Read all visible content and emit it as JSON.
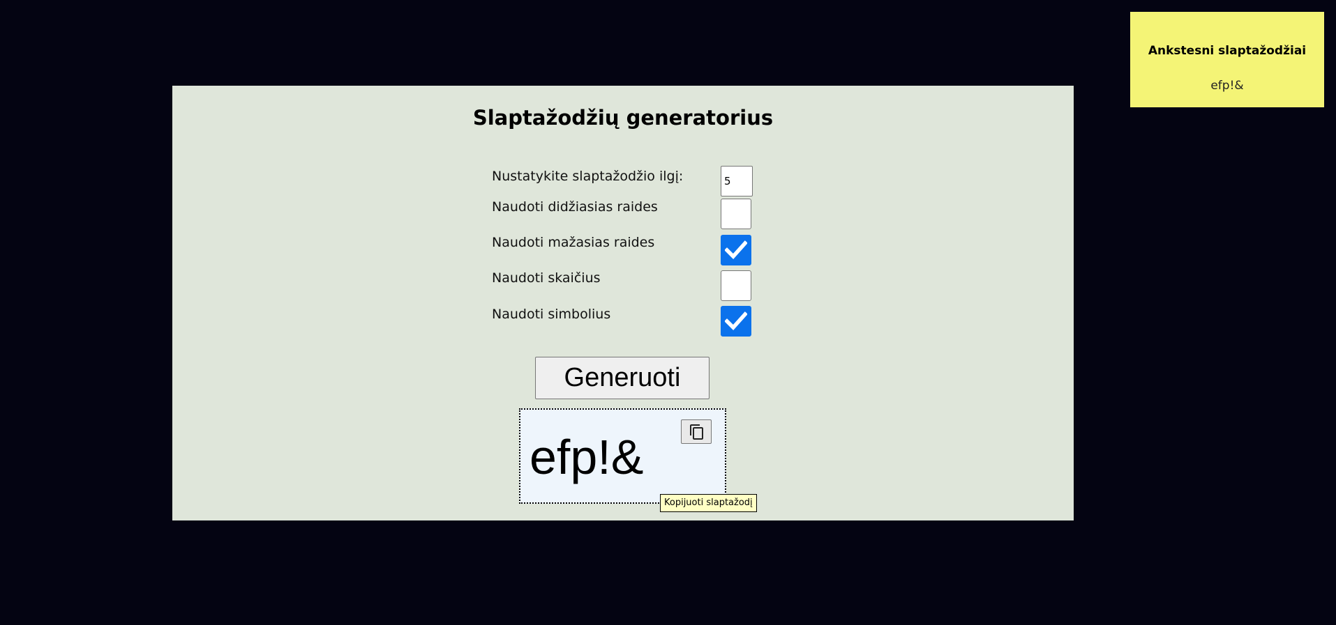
{
  "app": {
    "title": "Slaptažodžių generatorius"
  },
  "settings": {
    "length_label": "Nustatykite slaptažodžio ilgį:",
    "length_value": "5",
    "options": [
      {
        "label": "Naudoti didžiasias raides",
        "checked": false
      },
      {
        "label": "Naudoti mažasias raides",
        "checked": true
      },
      {
        "label": "Naudoti skaičius",
        "checked": false
      },
      {
        "label": "Naudoti simbolius",
        "checked": true
      }
    ]
  },
  "actions": {
    "generate_label": "Generuoti",
    "copy_tooltip": "Kopijuoti slaptažodį"
  },
  "result": {
    "password": "efp!&"
  },
  "history": {
    "title": "Ankstesni slaptažodžiai",
    "items": [
      "efp!&"
    ]
  },
  "colors": {
    "page_background": "#040412",
    "panel_background": "#dfe6da",
    "checkbox_accent": "#0b72ec",
    "result_background": "#eef5fc",
    "history_background": "#f4f476"
  },
  "icons": {
    "copy": "copy-icon",
    "checkmark": "checkmark-icon"
  }
}
